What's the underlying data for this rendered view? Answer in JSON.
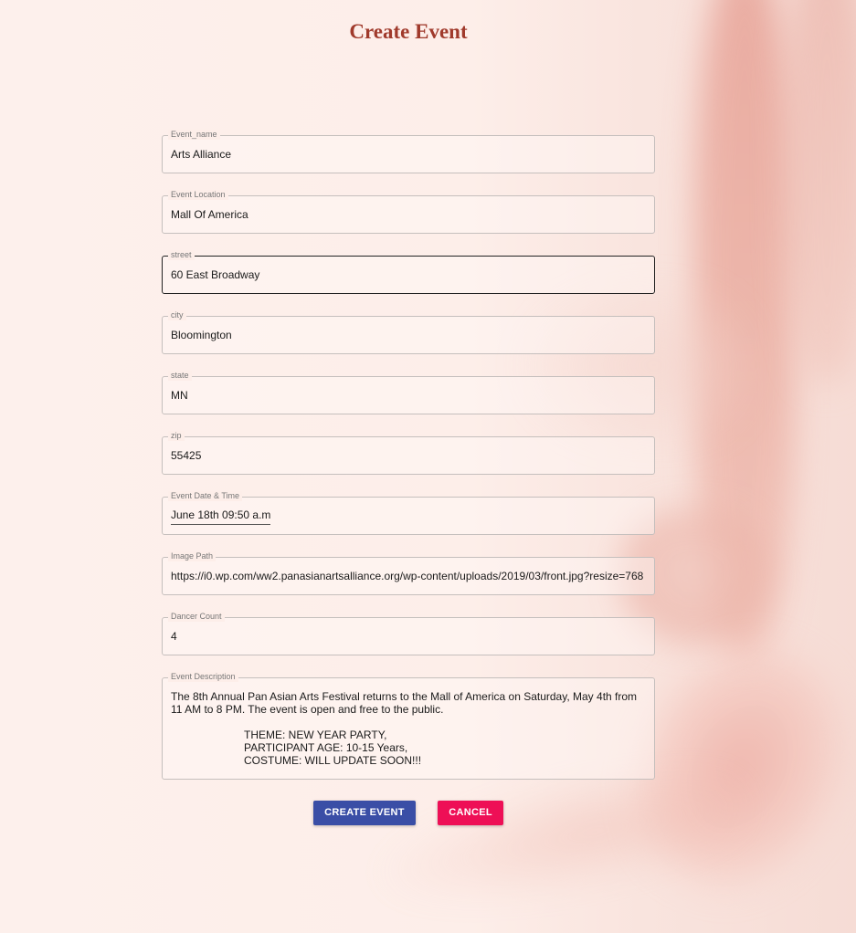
{
  "page": {
    "title": "Create Event"
  },
  "form": {
    "event_name": {
      "label": "Event_name",
      "value": "Arts Alliance"
    },
    "event_location": {
      "label": "Event Location",
      "value": "Mall Of America"
    },
    "street": {
      "label": "street",
      "value": "60 East Broadway"
    },
    "city": {
      "label": "city",
      "value": "Bloomington"
    },
    "state": {
      "label": "state",
      "value": "MN"
    },
    "zip": {
      "label": "zip",
      "value": "55425"
    },
    "event_datetime": {
      "label": "Event Date & Time",
      "value": "June 18th 09:50 a.m"
    },
    "image_path": {
      "label": "Image Path",
      "value": "https://i0.wp.com/ww2.panasianartsalliance.org/wp-content/uploads/2019/03/front.jpg?resize=768"
    },
    "dancer_count": {
      "label": "Dancer Count",
      "value": "4"
    },
    "event_description": {
      "label": "Event Description",
      "value": "The 8th Annual Pan Asian Arts Festival returns to the Mall of America on Saturday, May 4th from 11 AM to 8 PM. The event is open and free to the public.\n\n                        THEME: NEW YEAR PARTY,\n                        PARTICIPANT AGE: 10-15 Years,\n                        COSTUME: WILL UPDATE SOON!!!"
    }
  },
  "actions": {
    "create_label": "CREATE EVENT",
    "cancel_label": "CANCEL"
  },
  "colors": {
    "title": "#a03a2c",
    "create_button": "#3a4ea6",
    "cancel_button": "#ee0f56"
  }
}
